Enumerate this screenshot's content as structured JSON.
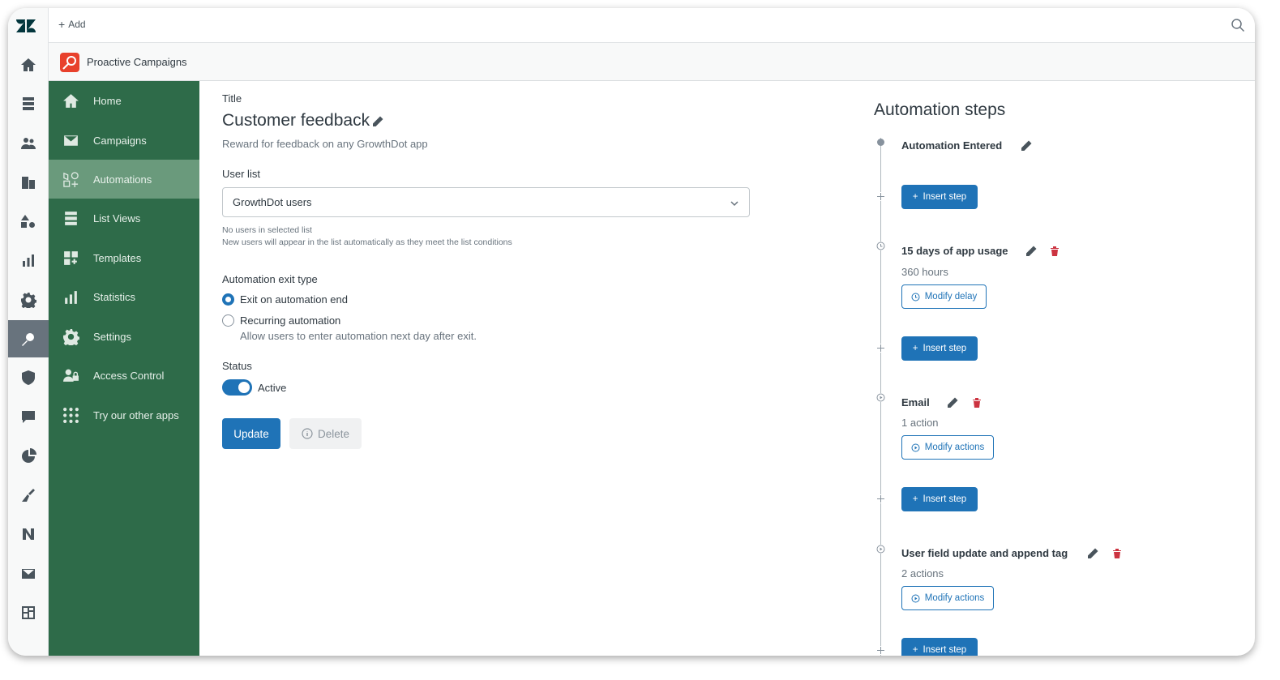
{
  "topbar": {
    "add_label": "Add"
  },
  "app": {
    "name": "Proactive Campaigns"
  },
  "nav": {
    "items": [
      {
        "label": "Home",
        "icon": "home-icon"
      },
      {
        "label": "Campaigns",
        "icon": "envelope-icon"
      },
      {
        "label": "Automations",
        "icon": "shapes-icon",
        "active": true
      },
      {
        "label": "List Views",
        "icon": "list-icon"
      },
      {
        "label": "Templates",
        "icon": "grid-plus-icon"
      },
      {
        "label": "Statistics",
        "icon": "bar-chart-icon"
      },
      {
        "label": "Settings",
        "icon": "gear-icon"
      },
      {
        "label": "Access Control",
        "icon": "users-lock-icon"
      },
      {
        "label": "Try our other apps",
        "icon": "dots-grid-icon"
      }
    ]
  },
  "form": {
    "title_label": "Title",
    "title_value": "Customer feedback",
    "description": "Reward for feedback on any GrowthDot app",
    "user_list_label": "User list",
    "user_list_value": "GrowthDot users",
    "hint_line1": "No users in selected list",
    "hint_line2": "New users will appear in the list automatically as they meet the list conditions",
    "exit_type_label": "Automation exit type",
    "exit_option1": "Exit on automation end",
    "exit_option2": "Recurring automation",
    "exit_option2_hint": "Allow users to enter automation next day after exit.",
    "status_label": "Status",
    "status_value": "Active",
    "update_label": "Update",
    "delete_label": "Delete"
  },
  "steps": {
    "title": "Automation steps",
    "insert_label": "Insert step",
    "items": [
      {
        "name": "Automation Entered"
      },
      {
        "name": "15 days of app usage",
        "sub": "360 hours",
        "action": "Modify delay"
      },
      {
        "name": "Email",
        "sub": "1 action",
        "action": "Modify actions"
      },
      {
        "name": "User field update and append tag",
        "sub": "2 actions",
        "action": "Modify actions"
      }
    ]
  },
  "colors": {
    "nav_bg": "#2e6b49",
    "nav_active": "#6a9a7c",
    "primary": "#1f73b7",
    "danger": "#cc3340"
  }
}
